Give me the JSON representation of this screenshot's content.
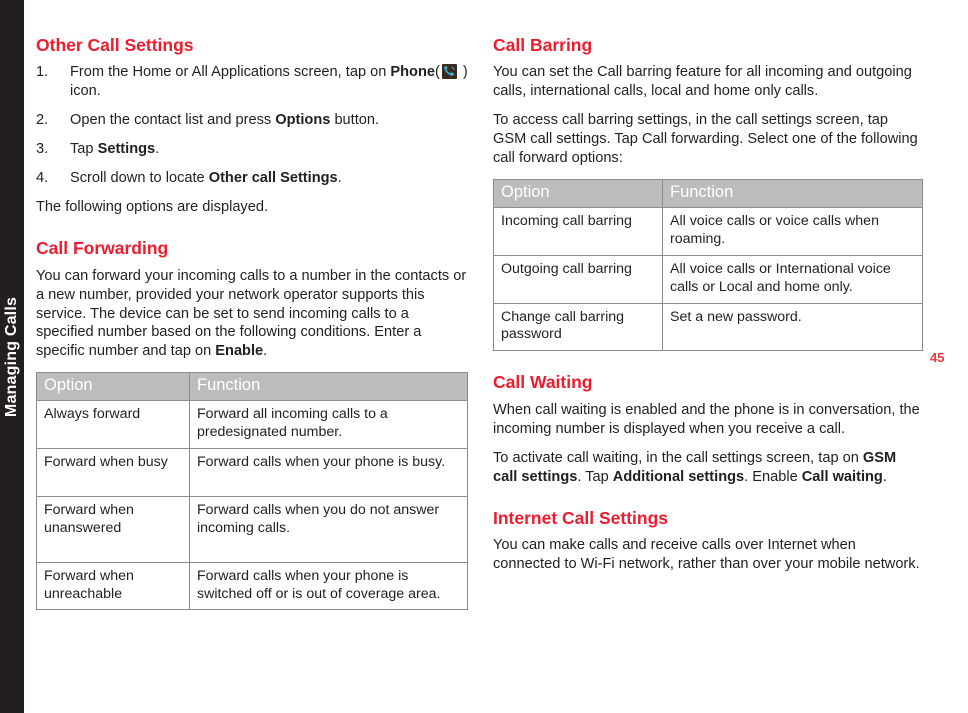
{
  "sidebar": {
    "chapter_label": "Managing Calls"
  },
  "page_number": "45",
  "colors": {
    "heading_red": "#ed1c2e",
    "page_number_red": "#ee3a43",
    "table_header_gray": "#bcbcbc",
    "edge_tab_dark": "#231f20"
  },
  "left_column": {
    "other_call_settings": {
      "heading": "Other Call Settings",
      "steps": [
        {
          "number": "1.",
          "text_before": "From the Home or All Applications screen, tap on ",
          "bold": "Phone",
          "icon": "phone-icon",
          "text_after": " ) icon.",
          "paren_open": "("
        },
        {
          "number": "2.",
          "text_before": "Open the contact list and press ",
          "bold": "Options",
          "text_after": " button."
        },
        {
          "number": "3.",
          "text_before": "Tap ",
          "bold": "Settings",
          "text_after": "."
        },
        {
          "number": "4.",
          "text_before": "Scroll down to locate ",
          "bold": "Other call Settings",
          "text_after": "."
        }
      ],
      "trailing_paragraph": "The following options are displayed."
    },
    "call_forwarding": {
      "heading": "Call Forwarding",
      "paragraph_before_bold": "You can forward your incoming calls to a number in the contacts or a new number, provided your network operator supports this service. The device can be set to send incoming calls to a specified number based on the following conditions. Enter a specific number and tap on ",
      "paragraph_bold": "Enable",
      "paragraph_after_bold": ".",
      "table": {
        "headers": [
          "Option",
          "Function"
        ],
        "rows": [
          [
            "Always forward",
            "Forward all incoming calls to a predesignated number."
          ],
          [
            "Forward when busy",
            "Forward calls when your phone is busy."
          ],
          [
            "Forward when unanswered",
            "Forward calls when you do not answer incoming calls."
          ],
          [
            "Forward when unreachable",
            "Forward calls when your phone is switched off or is out of coverage area."
          ]
        ]
      }
    }
  },
  "right_column": {
    "call_barring": {
      "heading": "Call Barring",
      "paragraph_1": "You can set the Call barring feature for all incoming and outgoing calls, international calls, local and home only calls.",
      "paragraph_2": "To access call barring settings, in the call settings screen, tap GSM call settings. Tap Call forwarding. Select one of the following call forward options:",
      "table": {
        "headers": [
          "Option",
          "Function"
        ],
        "rows": [
          [
            "Incoming call barring",
            "All voice calls or voice calls when roaming."
          ],
          [
            "Outgoing call barring",
            "All voice calls or International voice calls or Local and home only."
          ],
          [
            "Change call barring password",
            "Set a new password."
          ]
        ]
      }
    },
    "call_waiting": {
      "heading": "Call Waiting",
      "paragraph_1": "When call waiting is enabled and the phone is in conversation, the incoming number is displayed when you receive a call.",
      "paragraph_2": {
        "t1": "To activate call waiting, in the call settings screen, tap on ",
        "b1": "GSM call settings",
        "t2": ". Tap ",
        "b2": "Additional settings",
        "t3": ". Enable ",
        "b3": "Call waiting",
        "t4": "."
      }
    },
    "internet_call_settings": {
      "heading": "Internet Call Settings",
      "paragraph_1": "You can make calls and receive calls over Internet when connected to Wi-Fi network, rather than over your mobile network."
    }
  }
}
